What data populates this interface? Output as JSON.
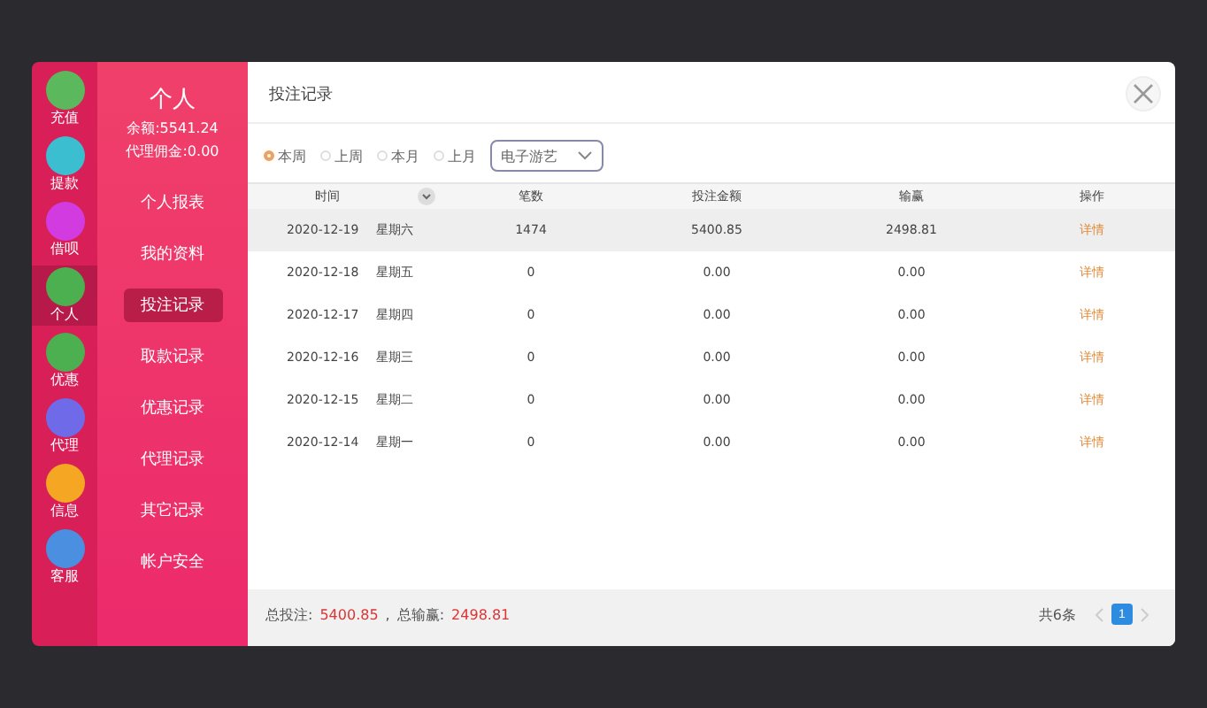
{
  "sidebar": {
    "icons": [
      {
        "label": "充值",
        "color": "#5cb85c",
        "selected": false
      },
      {
        "label": "提款",
        "color": "#3bbfd0",
        "selected": false
      },
      {
        "label": "借呗",
        "color": "#d13be0",
        "selected": false
      },
      {
        "label": "个人",
        "color": "#4caf50",
        "selected": true
      },
      {
        "label": "优惠",
        "color": "#4caf50",
        "selected": false
      },
      {
        "label": "代理",
        "color": "#6f6be8",
        "selected": false
      },
      {
        "label": "信息",
        "color": "#f5a623",
        "selected": false
      },
      {
        "label": "客服",
        "color": "#4a8fe0",
        "selected": false
      }
    ]
  },
  "profile": {
    "title": "个人",
    "balance": "余额:5541.24",
    "commission": "代理佣金:0.00"
  },
  "menu": [
    {
      "label": "个人报表",
      "selected": false
    },
    {
      "label": "我的资料",
      "selected": false
    },
    {
      "label": "投注记录",
      "selected": true
    },
    {
      "label": "取款记录",
      "selected": false
    },
    {
      "label": "优惠记录",
      "selected": false
    },
    {
      "label": "代理记录",
      "selected": false
    },
    {
      "label": "其它记录",
      "selected": false
    },
    {
      "label": "帐户安全",
      "selected": false
    }
  ],
  "dialog": {
    "title": "投注记录"
  },
  "filters": [
    {
      "label": "本周",
      "selected": true
    },
    {
      "label": "上周",
      "selected": false
    },
    {
      "label": "本月",
      "selected": false
    },
    {
      "label": "上月",
      "selected": false
    }
  ],
  "game_select": {
    "value": "电子游艺"
  },
  "table": {
    "columns": [
      "时间",
      "笔数",
      "投注金额",
      "输赢",
      "操作"
    ],
    "rows": [
      {
        "date": "2020-12-19",
        "weekday": "星期六",
        "count": "1474",
        "bet": "5400.85",
        "result": "2498.81",
        "action": "详情"
      },
      {
        "date": "2020-12-18",
        "weekday": "星期五",
        "count": "0",
        "bet": "0.00",
        "result": "0.00",
        "action": "详情"
      },
      {
        "date": "2020-12-17",
        "weekday": "星期四",
        "count": "0",
        "bet": "0.00",
        "result": "0.00",
        "action": "详情"
      },
      {
        "date": "2020-12-16",
        "weekday": "星期三",
        "count": "0",
        "bet": "0.00",
        "result": "0.00",
        "action": "详情"
      },
      {
        "date": "2020-12-15",
        "weekday": "星期二",
        "count": "0",
        "bet": "0.00",
        "result": "0.00",
        "action": "详情"
      },
      {
        "date": "2020-12-14",
        "weekday": "星期一",
        "count": "0",
        "bet": "0.00",
        "result": "0.00",
        "action": "详情"
      }
    ]
  },
  "footer": {
    "total_bet_label": "总投注:",
    "total_bet": "5400.85",
    "separator": ",",
    "total_win_label": "总输赢:",
    "total_win": "2498.81",
    "count": "共6条",
    "pages": [
      {
        "label": "1",
        "selected": true
      }
    ]
  }
}
